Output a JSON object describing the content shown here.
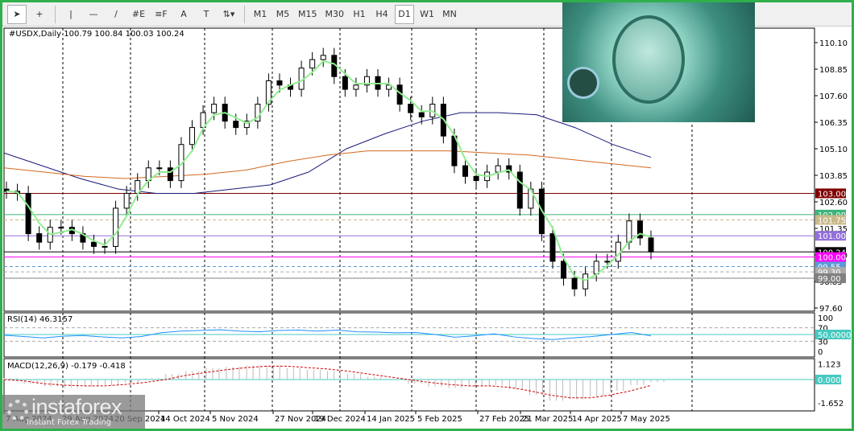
{
  "toolbar": {
    "tools": [
      {
        "name": "cursor-icon",
        "glyph": "➤"
      },
      {
        "name": "crosshair-icon",
        "glyph": "+"
      },
      {
        "name": "vertical-line-icon",
        "glyph": "|"
      },
      {
        "name": "horizontal-line-icon",
        "glyph": "—"
      },
      {
        "name": "trendline-icon",
        "glyph": "/"
      },
      {
        "name": "fibonacci-channel-icon",
        "glyph": "#E"
      },
      {
        "name": "fibonacci-icon",
        "glyph": "≡F"
      },
      {
        "name": "text-icon",
        "glyph": "A"
      },
      {
        "name": "text-label-icon",
        "glyph": "T"
      },
      {
        "name": "arrows-icon",
        "glyph": "⇅▾"
      }
    ],
    "timeframes": [
      "M1",
      "M5",
      "M15",
      "M30",
      "H1",
      "H4",
      "D1",
      "W1",
      "MN"
    ],
    "active_timeframe": "D1"
  },
  "logo": {
    "brand": "instaforex",
    "tagline": "Instant Forex Trading"
  },
  "chart_data": {
    "type": "candlestick",
    "title": "#USDX,Daily",
    "ohlc_label": "100.79 100.84 100.03 100.24",
    "ylim": [
      97.2,
      110.9
    ],
    "price_ticks": [
      "110.10",
      "108.85",
      "107.60",
      "106.35",
      "105.10",
      "103.85",
      "102.60",
      "101.35",
      "100.10",
      "98.85",
      "97.60"
    ],
    "x_labels": [
      "7 Aug 2024",
      "29 Aug 2024",
      "20 Sep 2024",
      "14 Oct 2024",
      "5 Nov 2024",
      "27 Nov 2024",
      "19 Dec 2024",
      "14 Jan 2025",
      "5 Feb 2025",
      "27 Feb 2025",
      "21 Mar 2025",
      "14 Apr 2025",
      "7 May 2025"
    ],
    "closes": [
      103.1,
      103.0,
      101.1,
      100.7,
      101.4,
      101.4,
      101.1,
      100.7,
      100.5,
      100.5,
      102.3,
      103.0,
      103.6,
      104.2,
      104.2,
      103.6,
      105.3,
      106.1,
      106.8,
      107.2,
      106.4,
      106.1,
      106.4,
      107.2,
      108.3,
      108.1,
      107.9,
      108.9,
      109.3,
      109.5,
      108.5,
      107.9,
      108.1,
      108.5,
      107.9,
      108.1,
      107.2,
      106.8,
      106.6,
      107.2,
      105.7,
      104.3,
      103.8,
      103.6,
      104.0,
      104.3,
      104.0,
      102.3,
      103.2,
      101.1,
      99.8,
      99.0,
      98.5,
      99.2,
      99.8,
      99.8,
      100.7,
      101.7,
      100.9,
      100.24
    ],
    "ma_slow_blue": [
      104.9,
      104.3,
      103.7,
      103.2,
      103.0,
      103.0,
      103.2,
      103.4,
      104.0,
      105.1,
      105.8,
      106.4,
      106.8,
      106.8,
      106.7,
      106.1,
      105.3,
      104.7
    ],
    "ma_long_orange": [
      104.2,
      104.0,
      103.8,
      103.7,
      103.8,
      103.9,
      104.1,
      104.5,
      104.8,
      105.0,
      105.0,
      105.0,
      104.9,
      104.8,
      104.6,
      104.4,
      104.2
    ],
    "levels": [
      {
        "price": "103.00",
        "color": "#800000",
        "style": "solid"
      },
      {
        "price": "102.00",
        "color": "#3cb37a",
        "style": "solid"
      },
      {
        "price": "101.75",
        "color": "#c8b88a",
        "style": "dashed"
      },
      {
        "price": "101.00",
        "color": "#9370db",
        "style": "solid"
      },
      {
        "price": "100.24",
        "color": "#000000",
        "style": "solid"
      },
      {
        "price": "100.00",
        "color": "#ff00ff",
        "style": "solid"
      },
      {
        "price": "99.55",
        "color": "#5b9bd5",
        "style": "dashed"
      },
      {
        "price": "99.30",
        "color": "#aaaaaa",
        "style": "dashed"
      },
      {
        "price": "99.00",
        "color": "#808080",
        "style": "solid"
      }
    ],
    "rsi": {
      "label": "RSI(14) 46.3157",
      "ticks": [
        "100",
        "70",
        "50.0000",
        "30",
        "0"
      ],
      "values": [
        48,
        44,
        40,
        45,
        47,
        43,
        40,
        44,
        55,
        60,
        62,
        64,
        60,
        58,
        62,
        63,
        60,
        63,
        58,
        57,
        55,
        56,
        50,
        42,
        46,
        52,
        43,
        38,
        35,
        40,
        44,
        50,
        56,
        46
      ]
    },
    "macd": {
      "label": "MACD(12,26,9) -0.179 -0.418",
      "ticks": [
        "1.123",
        "0.000",
        "-1.652"
      ],
      "hist": [
        0.1,
        -0.3,
        -0.5,
        -0.6,
        -0.5,
        -0.4,
        -0.2,
        0.1,
        0.4,
        0.6,
        0.8,
        0.9,
        1.0,
        1.0,
        0.8,
        0.7,
        0.6,
        0.4,
        0.2,
        0.0,
        -0.3,
        -0.5,
        -0.6,
        -0.5,
        -0.4,
        -0.7,
        -1.1,
        -1.5,
        -1.4,
        -1.2,
        -0.8,
        -0.4,
        -0.18
      ],
      "signal": [
        0.0,
        -0.1,
        -0.3,
        -0.4,
        -0.45,
        -0.45,
        -0.35,
        -0.2,
        0.0,
        0.3,
        0.5,
        0.7,
        0.85,
        0.95,
        0.95,
        0.85,
        0.75,
        0.6,
        0.4,
        0.2,
        0.0,
        -0.2,
        -0.35,
        -0.45,
        -0.45,
        -0.55,
        -0.8,
        -1.1,
        -1.3,
        -1.3,
        -1.1,
        -0.8,
        -0.418
      ]
    }
  }
}
